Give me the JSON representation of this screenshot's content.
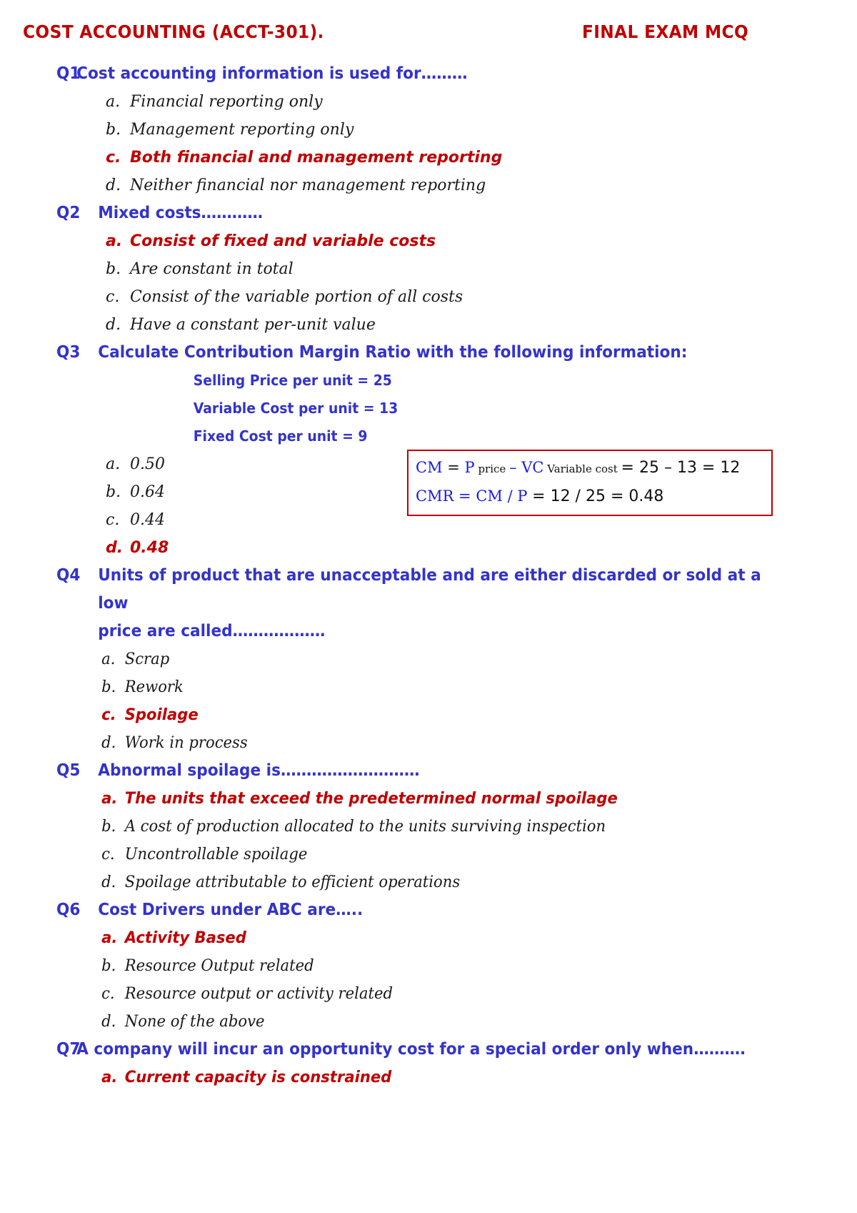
{
  "header": {
    "left_title": "COST ACCOUNTING (ACCT-301).",
    "right_title": "FINAL EXAM MCQ"
  },
  "colors": {
    "question_blue": "#3333CC",
    "answer_red": "#C00000",
    "option_black": "#1a1a1a",
    "formula_blue": "#1a1aE6",
    "box_border": "#C00000"
  },
  "questions": [
    {
      "num": "Q1",
      "stem": "Cost accounting information is used for………",
      "continuation": "",
      "givens": [],
      "options": [
        {
          "key": "a.",
          "label": "Financial reporting only",
          "correct": false
        },
        {
          "key": "b.",
          "label": "Management reporting only",
          "correct": false
        },
        {
          "key": "c.",
          "label": "Both financial and management reporting",
          "correct": true
        },
        {
          "key": "d.",
          "label": "Neither financial nor management reporting",
          "correct": false
        }
      ]
    },
    {
      "num": "Q2",
      "stem": "Mixed costs…………",
      "continuation": "",
      "givens": [],
      "options": [
        {
          "key": "a.",
          "label": "Consist of fixed and variable costs",
          "correct": true
        },
        {
          "key": "b.",
          "label": "Are constant in total",
          "correct": false
        },
        {
          "key": "c.",
          "label": "Consist of the variable portion of all costs",
          "correct": false
        },
        {
          "key": "d.",
          "label": "Have a constant per-unit value",
          "correct": false
        }
      ]
    },
    {
      "num": "Q3",
      "stem": "Calculate Contribution Margin Ratio with the following information:",
      "continuation": "",
      "givens": [
        "Selling Price per unit = 25",
        "Variable Cost per unit = 13",
        "Fixed Cost per unit   = 9"
      ],
      "options": [
        {
          "key": "a.",
          "label": "0.50",
          "correct": false
        },
        {
          "key": "b.",
          "label": "0.64",
          "correct": false
        },
        {
          "key": "c.",
          "label": "0.44",
          "correct": false
        },
        {
          "key": "d.",
          "label": "0.48",
          "correct": true
        }
      ]
    },
    {
      "num": "Q4",
      "stem": "Units of product that are unacceptable and are either discarded or sold at a low",
      "continuation": "price are called………………",
      "givens": [],
      "options": [
        {
          "key": "a.",
          "label": "Scrap",
          "correct": false
        },
        {
          "key": "b.",
          "label": "Rework",
          "correct": false
        },
        {
          "key": "c.",
          "label": "Spoilage",
          "correct": true
        },
        {
          "key": "d.",
          "label": "Work in process",
          "correct": false
        }
      ]
    },
    {
      "num": "Q5",
      "stem": "Abnormal spoilage is………………………",
      "continuation": "",
      "givens": [],
      "options": [
        {
          "key": "a.",
          "label": "The units that exceed the predetermined normal spoilage",
          "correct": true
        },
        {
          "key": "b.",
          "label": "A cost of production allocated to the units surviving inspection",
          "correct": false
        },
        {
          "key": "c.",
          "label": "Uncontrollable spoilage",
          "correct": false
        },
        {
          "key": "d.",
          "label": "Spoilage attributable to efficient operations",
          "correct": false
        }
      ]
    },
    {
      "num": "Q6",
      "stem": "Cost Drivers under ABC are…..",
      "continuation": "",
      "givens": [],
      "options": [
        {
          "key": "a.",
          "label": "Activity Based",
          "correct": true
        },
        {
          "key": "b.",
          "label": "Resource Output related",
          "correct": false
        },
        {
          "key": "c.",
          "label": "Resource output or activity related",
          "correct": false
        },
        {
          "key": "d.",
          "label": "None of the above",
          "correct": false
        }
      ]
    },
    {
      "num": "Q7",
      "stem": "A company will incur an opportunity cost for a special order only when……….",
      "continuation": "",
      "givens": [],
      "options": [
        {
          "key": "a.",
          "label": "Current capacity is constrained",
          "correct": true
        }
      ]
    }
  ],
  "formula_box": {
    "line1": {
      "term1": "CM",
      "eq1": " = ",
      "term2": "P",
      "sub2": " price ",
      "minus": "– ",
      "term3": "VC",
      "sub3": " Variable cost ",
      "eq2": "= ",
      "result": "25  –  13  =  12"
    },
    "line2": {
      "expr": "CMR = CM / P ",
      "result": "= 12 / 25 = 0.48"
    }
  }
}
